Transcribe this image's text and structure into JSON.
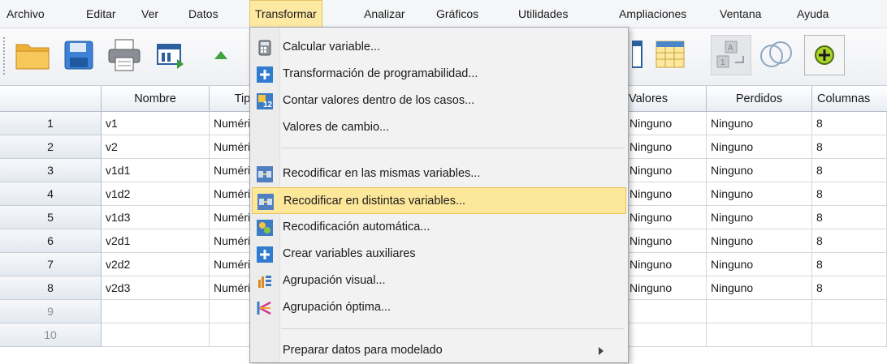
{
  "menubar": {
    "items": [
      "Archivo",
      "Editar",
      "Ver",
      "Datos",
      "Transformar",
      "Analizar",
      "Gráficos",
      "Utilidades",
      "Ampliaciones",
      "Ventana",
      "Ayuda"
    ],
    "active": "Transformar"
  },
  "toolbar": {
    "buttons": [
      "open-folder-icon",
      "save-icon",
      "print-icon",
      "recall-dialog-icon",
      "undo-icon"
    ],
    "right_buttons": [
      "insert-variable-icon",
      "split-file-icon",
      "value-labels-icon",
      "use-variable-sets-icon",
      "add-icon"
    ]
  },
  "grid": {
    "columns": [
      "",
      "Nombre",
      "Tipo",
      "Valores",
      "Perdidos",
      "Columnas"
    ],
    "rows": [
      {
        "n": "1",
        "nombre": "v1",
        "tipo": "Numérico",
        "valores": "Ninguno",
        "perdidos": "Ninguno",
        "columnas": "8"
      },
      {
        "n": "2",
        "nombre": "v2",
        "tipo": "Numérico",
        "valores": "Ninguno",
        "perdidos": "Ninguno",
        "columnas": "8"
      },
      {
        "n": "3",
        "nombre": "v1d1",
        "tipo": "Numérico",
        "valores": "Ninguno",
        "perdidos": "Ninguno",
        "columnas": "8"
      },
      {
        "n": "4",
        "nombre": "v1d2",
        "tipo": "Numérico",
        "valores": "Ninguno",
        "perdidos": "Ninguno",
        "columnas": "8"
      },
      {
        "n": "5",
        "nombre": "v1d3",
        "tipo": "Numérico",
        "valores": "Ninguno",
        "perdidos": "Ninguno",
        "columnas": "8"
      },
      {
        "n": "6",
        "nombre": "v2d1",
        "tipo": "Numérico",
        "valores": "Ninguno",
        "perdidos": "Ninguno",
        "columnas": "8"
      },
      {
        "n": "7",
        "nombre": "v2d2",
        "tipo": "Numérico",
        "valores": "Ninguno",
        "perdidos": "Ninguno",
        "columnas": "8"
      },
      {
        "n": "8",
        "nombre": "v2d3",
        "tipo": "Numérico",
        "valores": "Ninguno",
        "perdidos": "Ninguno",
        "columnas": "8"
      },
      {
        "n": "9",
        "nombre": "",
        "tipo": "",
        "valores": "",
        "perdidos": "",
        "columnas": ""
      },
      {
        "n": "10",
        "nombre": "",
        "tipo": "",
        "valores": "",
        "perdidos": "",
        "columnas": ""
      }
    ]
  },
  "transform_menu": {
    "items": [
      {
        "label": "Calcular variable...",
        "icon": "calculator-icon"
      },
      {
        "label": "Transformación de programabilidad...",
        "icon": "plus-icon"
      },
      {
        "label": "Contar valores dentro de los casos...",
        "icon": "count-icon"
      },
      {
        "label": "Valores de cambio...",
        "icon": ""
      },
      {
        "label": "Recodificar en las mismas variables...",
        "icon": "recode-same-icon"
      },
      {
        "label": "Recodificar en distintas variables...",
        "icon": "recode-different-icon",
        "highlighted": true
      },
      {
        "label": "Recodificación automática...",
        "icon": "auto-recode-icon"
      },
      {
        "label": "Crear variables auxiliares",
        "icon": "plus-icon"
      },
      {
        "label": "Agrupación visual...",
        "icon": "visual-binning-icon"
      },
      {
        "label": "Agrupación óptima...",
        "icon": "optimal-binning-icon"
      },
      {
        "label": "Preparar datos para modelado",
        "icon": "",
        "submenu": true
      }
    ]
  },
  "colors": {
    "menu_highlight": "#fde79b",
    "menu_highlight_border": "#e8c255",
    "accent_blue": "#2e7bcf"
  }
}
